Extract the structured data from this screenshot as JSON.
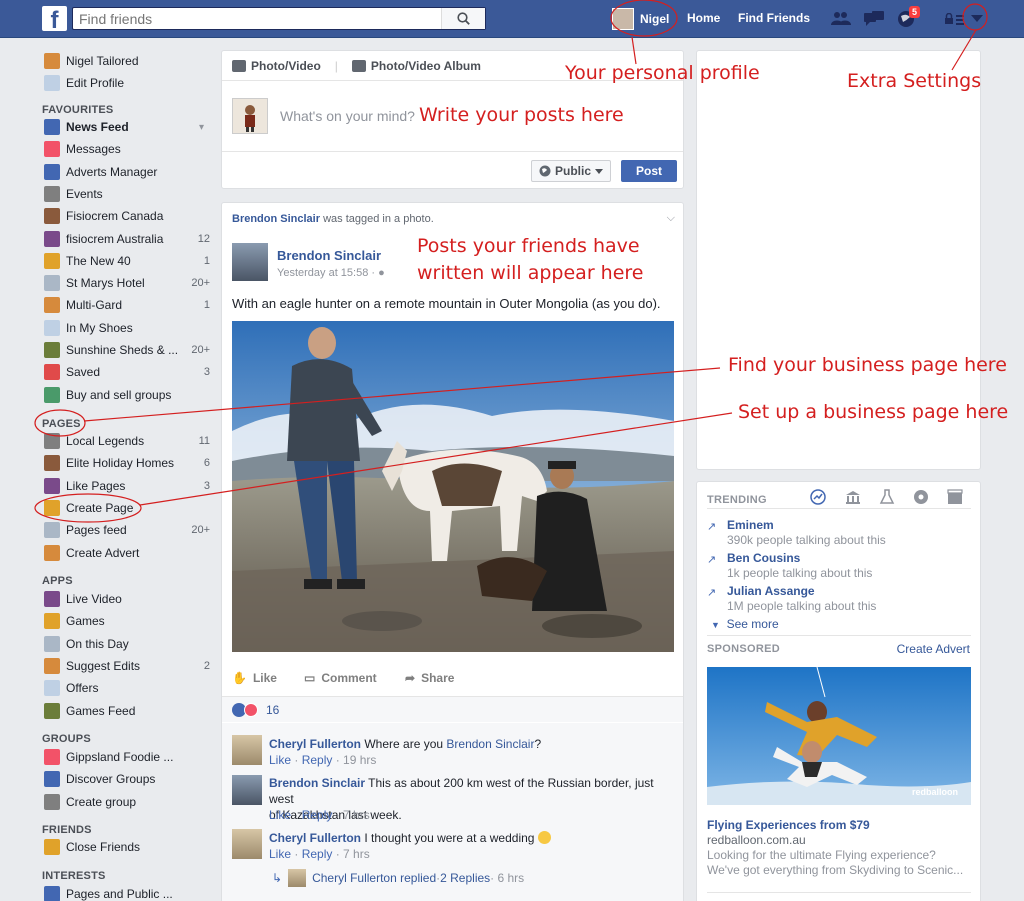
{
  "topbar": {
    "logo": "f",
    "search_placeholder": "Find friends",
    "profile_name": "Nigel",
    "home_label": "Home",
    "find_friends_label": "Find Friends",
    "notification_count": "5",
    "brand_color": "#3b5998"
  },
  "sidebar": {
    "profile_items": [
      {
        "label": "Nigel Tailored",
        "icon": "avatar-icon"
      },
      {
        "label": "Edit Profile",
        "icon": "pencil-icon"
      }
    ],
    "favourites_header": "FAVOURITES",
    "favourites": [
      {
        "label": "News Feed",
        "count": "",
        "icon": "news-feed-icon"
      },
      {
        "label": "Messages",
        "count": "",
        "icon": "messages-icon"
      },
      {
        "label": "Adverts Manager",
        "count": "",
        "icon": "chart-icon"
      },
      {
        "label": "Events",
        "count": "",
        "icon": "calendar-icon"
      },
      {
        "label": "Fisiocrem Canada",
        "count": "",
        "icon": "page-icon"
      },
      {
        "label": "fisiocrem Australia",
        "count": "12",
        "icon": "page-icon"
      },
      {
        "label": "The New 40",
        "count": "1",
        "icon": "page-icon"
      },
      {
        "label": "St Marys Hotel",
        "count": "20+",
        "icon": "pin-icon"
      },
      {
        "label": "Multi-Gard",
        "count": "1",
        "icon": "page-icon"
      },
      {
        "label": "In My Shoes",
        "count": "",
        "icon": "page-icon"
      },
      {
        "label": "Sunshine Sheds & ...",
        "count": "20+",
        "icon": "page-icon"
      },
      {
        "label": "Saved",
        "count": "3",
        "icon": "bookmark-icon"
      },
      {
        "label": "Buy and sell groups",
        "count": "",
        "icon": "tag-icon"
      }
    ],
    "pages_header": "PAGES",
    "pages": [
      {
        "label": "Local Legends",
        "count": "11",
        "icon": "page-icon"
      },
      {
        "label": "Elite Holiday Homes",
        "count": "6",
        "icon": "page-icon"
      },
      {
        "label": "Like Pages",
        "count": "3",
        "icon": "flag-icon"
      },
      {
        "label": "Create Page",
        "count": "",
        "icon": "plus-page-icon"
      },
      {
        "label": "Pages feed",
        "count": "20+",
        "icon": "pages-feed-icon"
      },
      {
        "label": "Create Advert",
        "count": "",
        "icon": "chart-icon"
      }
    ],
    "apps_header": "APPS",
    "apps": [
      {
        "label": "Live Video",
        "count": "",
        "icon": "video-icon"
      },
      {
        "label": "Games",
        "count": "",
        "icon": "dice-icon"
      },
      {
        "label": "On this Day",
        "count": "",
        "icon": "clock-icon"
      },
      {
        "label": "Suggest Edits",
        "count": "2",
        "icon": "pencil-icon"
      },
      {
        "label": "Offers",
        "count": "",
        "icon": "offers-icon"
      },
      {
        "label": "Games Feed",
        "count": "",
        "icon": "gamepad-icon"
      }
    ],
    "groups_header": "GROUPS",
    "groups": [
      {
        "label": "Gippsland Foodie ...",
        "count": "",
        "icon": "group-icon"
      },
      {
        "label": "Discover Groups",
        "count": "",
        "icon": "compass-icon"
      },
      {
        "label": "Create group",
        "count": "",
        "icon": "plus-icon"
      }
    ],
    "friends_header": "FRIENDS",
    "friends": [
      {
        "label": "Close Friends",
        "count": "",
        "icon": "star-icon"
      }
    ],
    "interests_header": "INTERESTS",
    "interests": [
      {
        "label": "Pages and Public ...",
        "count": "",
        "icon": "rss-icon"
      }
    ]
  },
  "composer": {
    "tab_photo": "Photo/Video",
    "tab_album": "Photo/Video Album",
    "placeholder": "What's on your mind?",
    "privacy_label": "Public",
    "post_label": "Post"
  },
  "post": {
    "story_actor": "Brendon Sinclair",
    "story_rest": " was tagged in a photo.",
    "author": "Brendon Sinclair",
    "time": "Yesterday at 15:58 · ",
    "text": "With an eagle hunter on a remote mountain in Outer Mongolia (as you do).",
    "like_label": "Like",
    "comment_label": "Comment",
    "share_label": "Share",
    "reaction_count": "16"
  },
  "comments": [
    {
      "author": "Cheryl Fullerton",
      "text": " Where are you ",
      "mention": "Brendon Sinclair",
      "tail": "?",
      "meta_like": "Like",
      "meta_reply": "Reply",
      "meta_time": " · 19 hrs"
    },
    {
      "author": "Brendon Sinclair",
      "text": " This as about 200 km west of the Russian border, just west",
      "line2": "of Kazakhstan last week.",
      "meta_like": "Like",
      "meta_reply": "Reply",
      "meta_time": " · 7 hrs"
    },
    {
      "author": "Cheryl Fullerton",
      "text": " I thought you were at a wedding ",
      "meta_like": "Like",
      "meta_reply": "Reply",
      "meta_time": " · 7 hrs"
    }
  ],
  "reply_summary": {
    "actor": "Cheryl Fullerton replied",
    "dot": " · ",
    "replies": "2 Replies",
    "time": " · 6 hrs"
  },
  "trending": {
    "title": "TRENDING",
    "items": [
      {
        "name": "Eminem",
        "sub": "390k people talking about this"
      },
      {
        "name": "Ben Cousins",
        "sub": "1k people talking about this"
      },
      {
        "name": "Julian Assange",
        "sub": "1M people talking about this"
      }
    ],
    "see_more": "See more"
  },
  "sponsored": {
    "label": "SPONSORED",
    "create_advert": "Create Advert",
    "ad_brand_watermark": "redballoon",
    "ad_title": "Flying Experiences from $79",
    "ad_url": "redballoon.com.au",
    "ad_desc": "Looking for the ultimate Flying experience? We've got everything from Skydiving to Scenic..."
  },
  "annotations": {
    "profile": "Your personal profile",
    "settings": "Extra Settings",
    "write": "Write your posts here",
    "friends_line1": "Posts your friends have",
    "friends_line2": "written will appear here",
    "find_business": "Find your business page here",
    "setup_business": "Set up a business page here",
    "color": "#d41f1f"
  }
}
